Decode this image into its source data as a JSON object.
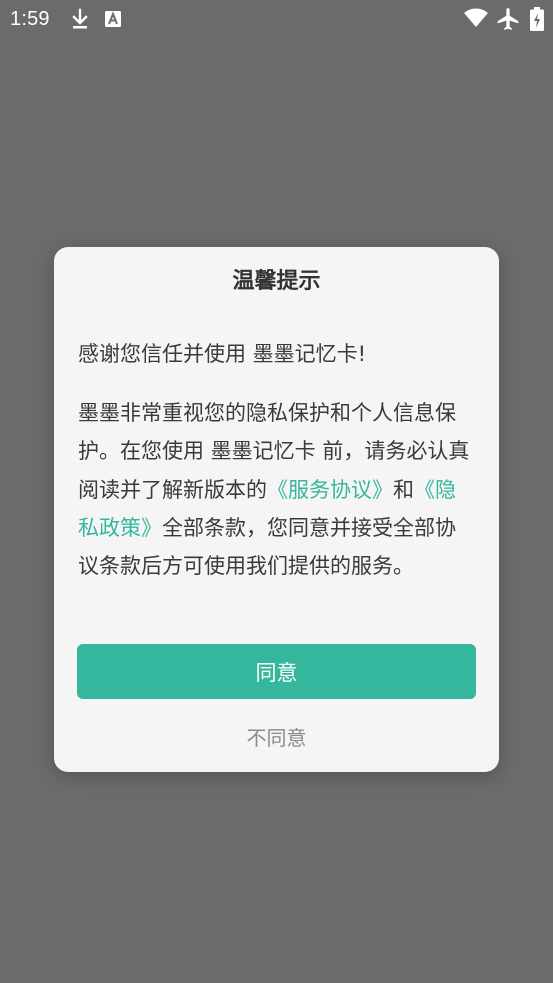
{
  "status_bar": {
    "time": "1:59",
    "left_icons": [
      "download-icon",
      "a-notification-icon"
    ],
    "right_icons": [
      "wifi-icon",
      "airplane-mode-icon",
      "battery-icon"
    ]
  },
  "dialog": {
    "title": "温馨提示",
    "intro": "感谢您信任并使用 墨墨记忆卡!",
    "body": {
      "part1": "墨墨非常重视您的隐私保护和个人信息保护。在您使用 墨墨记忆卡 前，请务必认真阅读并了解新版本的",
      "service_link": "《服务协议》",
      "connector": "和",
      "privacy_link": "《隐私政策》",
      "part2": "全部条款，您同意并接受全部协议条款后方可使用我们提供的服务。"
    },
    "agree_label": "同意",
    "disagree_label": "不同意"
  },
  "colors": {
    "accent": "#35b79d",
    "overlay": "#6b6b6b",
    "dialog_bg": "#f5f5f5",
    "text": "#3a3a3a",
    "muted": "#8a8a8a"
  }
}
